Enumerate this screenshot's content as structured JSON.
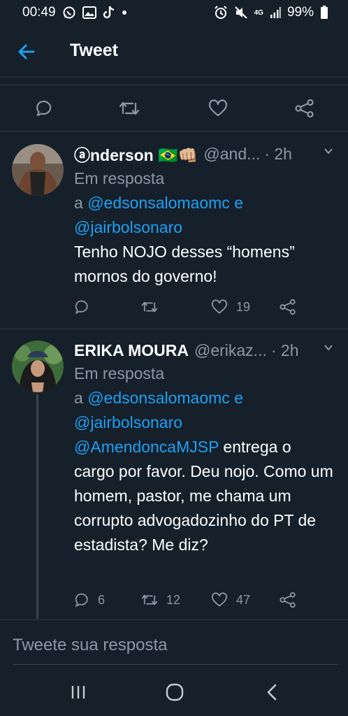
{
  "status_bar": {
    "time": "00:49",
    "network": "4G",
    "battery": "99%",
    "icons_left": [
      "whatsapp-icon",
      "gallery-icon",
      "tiktok-icon",
      "dot-icon"
    ],
    "icons_right": [
      "alarm-icon",
      "mute-icon",
      "network-icon",
      "signal-icon",
      "battery-icon"
    ]
  },
  "header": {
    "title": "Tweet"
  },
  "main_actions": [
    "reply-icon",
    "retweet-icon",
    "like-icon",
    "share-icon"
  ],
  "tweets": [
    {
      "author_name": "ⓐnderson 🇧🇷👊🏼",
      "handle": "@and...",
      "time": "· 2h",
      "reply_prefix": "Em resposta",
      "reply_a": "a",
      "mention_1": "@edsonsalomaomc",
      "reply_and": "e",
      "mention_2": "@jairbolsonaro",
      "text": "Tenho NOJO desses “homens” mornos do governo!",
      "replies": "",
      "retweets": "",
      "likes": "19"
    },
    {
      "author_name": "ERIKA MOURA",
      "handle": "@erikaz...",
      "time": "· 2h",
      "reply_prefix": "Em resposta",
      "reply_a": "a",
      "mention_1": "@edsonsalomaomc",
      "reply_and": "e",
      "mention_2": "@jairbolsonaro",
      "mention_3": "@AmendoncaMJSP",
      "text": "entrega o cargo por favor. Deu nojo. Como um homem, pastor,  me chama um corrupto advogadozinho do PT de estadista? Me diz?",
      "replies": "6",
      "retweets": "12",
      "likes": "47"
    }
  ],
  "reply_box": {
    "placeholder": "Tweete sua resposta"
  },
  "nav_bar": {
    "buttons": [
      "recent-apps-icon",
      "home-icon",
      "back-icon"
    ]
  },
  "colors": {
    "background": "#15202b",
    "link": "#1da1f2",
    "muted": "#8b98a5",
    "divider": "#38444d"
  }
}
